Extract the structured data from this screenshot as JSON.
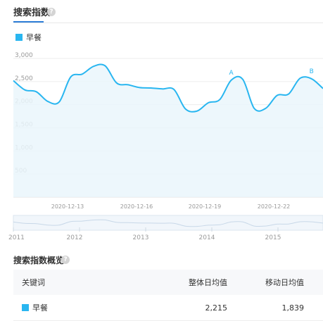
{
  "header": {
    "title": "搜索指数",
    "help_icon": "question-circle-icon"
  },
  "chart_data": {
    "type": "area",
    "legend": [
      {
        "name": "早餐",
        "color": "#29b6f0"
      }
    ],
    "y_ticks": [
      "3,000",
      "2,500",
      "2,000",
      "1,500",
      "1,000",
      "500"
    ],
    "ylim": [
      0,
      3000
    ],
    "x_tick_labels": [
      "2020-12-13",
      "2020-12-16",
      "2020-12-19",
      "2020-12-22"
    ],
    "series": [
      {
        "name": "早餐",
        "color": "#29b6f0",
        "values": [
          2520,
          2320,
          2280,
          2070,
          2060,
          2600,
          2660,
          2830,
          2840,
          2470,
          2430,
          2370,
          2360,
          2340,
          2330,
          1910,
          1860,
          2040,
          2110,
          2530,
          2550,
          1920,
          1920,
          2200,
          2230,
          2570,
          2560,
          2350
        ]
      }
    ],
    "annotations": [
      {
        "label": "A",
        "index": 19
      },
      {
        "label": "B",
        "index": 26
      }
    ],
    "grid": true
  },
  "navigator": {
    "year_labels": [
      "2011",
      "2012",
      "2013",
      "2014",
      "2015"
    ]
  },
  "overview": {
    "title": "搜索指数概览",
    "help_icon": "question-circle-icon",
    "columns": {
      "keyword": "关键词",
      "overall_avg": "整体日均值",
      "mobile_avg": "移动日均值"
    },
    "rows": [
      {
        "keyword": "早餐",
        "overall_avg": "2,215",
        "mobile_avg": "1,839"
      }
    ]
  }
}
